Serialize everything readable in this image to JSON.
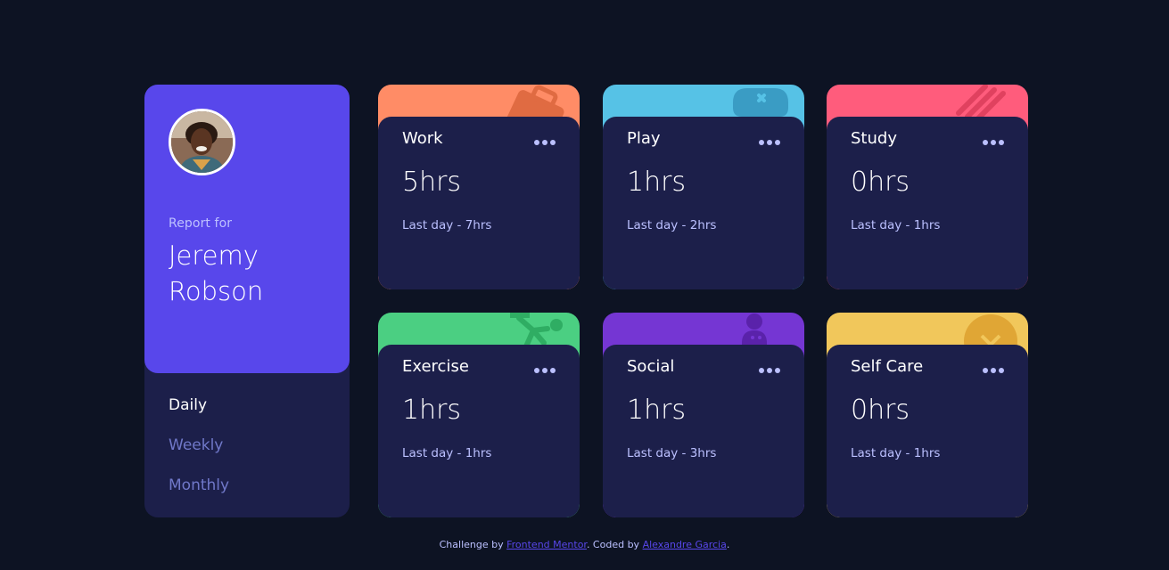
{
  "profile": {
    "report_for": "Report for",
    "first_name": "Jeremy",
    "last_name": "Robson",
    "periods": [
      "Daily",
      "Weekly",
      "Monthly"
    ],
    "active_period": "Daily"
  },
  "cards": [
    {
      "title": "Work",
      "hours": "5hrs",
      "previous": "Last day - 7hrs",
      "color": "#ff8c66",
      "icon": "briefcase-icon"
    },
    {
      "title": "Play",
      "hours": "1hrs",
      "previous": "Last day - 2hrs",
      "color": "#56c2e6",
      "icon": "gamepad-icon"
    },
    {
      "title": "Study",
      "hours": "0hrs",
      "previous": "Last day - 1hrs",
      "color": "#ff5c7c",
      "icon": "book-icon"
    },
    {
      "title": "Exercise",
      "hours": "1hrs",
      "previous": "Last day - 1hrs",
      "color": "#4bcf82",
      "icon": "running-icon"
    },
    {
      "title": "Social",
      "hours": "1hrs",
      "previous": "Last day - 3hrs",
      "color": "#7536d3",
      "icon": "social-icon"
    },
    {
      "title": "Self Care",
      "hours": "0hrs",
      "previous": "Last day - 1hrs",
      "color": "#f1c75b",
      "icon": "self-care-icon"
    }
  ],
  "footer": {
    "prefix": "Challenge by ",
    "link1": "Frontend Mentor",
    "middle": ". Coded by ",
    "link2": "Alexandre Garcia",
    "suffix": "."
  }
}
